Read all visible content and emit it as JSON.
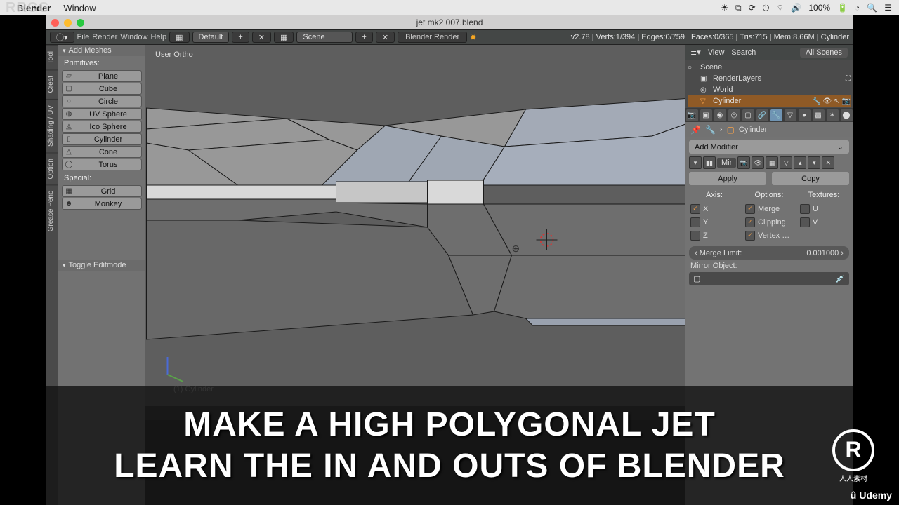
{
  "menubar": {
    "app": "Blender",
    "items": [
      "Window"
    ],
    "battery": "100%"
  },
  "window": {
    "title": "jet mk2 007.blend"
  },
  "top": {
    "file": "File",
    "render": "Render",
    "window": "Window",
    "help": "Help",
    "layout": "Default",
    "scene_label": "Scene",
    "engine": "Blender Render",
    "stats": "v2.78 | Verts:1/394 | Edges:0/759 | Faces:0/365 | Tris:715 | Mem:8.66M | Cylinder"
  },
  "left_tabs": [
    "Tool",
    "Creat",
    "Shading / UV",
    "Option",
    "Grease Penc"
  ],
  "toolshelf": {
    "panel": "Add Meshes",
    "primitives_label": "Primitives:",
    "primitives": [
      "Plane",
      "Cube",
      "Circle",
      "UV Sphere",
      "Ico Sphere",
      "Cylinder",
      "Cone",
      "Torus"
    ],
    "special_label": "Special:",
    "special": [
      "Grid",
      "Monkey"
    ],
    "op_panel": "Toggle Editmode"
  },
  "viewport": {
    "projection": "User Ortho",
    "obj": "(1) Cylinder"
  },
  "outliner": {
    "view": "View",
    "search": "Search",
    "filter": "All Scenes",
    "scene": "Scene",
    "renderlayers": "RenderLayers",
    "world": "World",
    "cylinder": "Cylinder"
  },
  "props": {
    "crumb_obj": "Cylinder",
    "add_modifier": "Add Modifier",
    "mod_name": "Mir",
    "apply": "Apply",
    "copy": "Copy",
    "axis": "Axis:",
    "options": "Options:",
    "textures": "Textures:",
    "x": "X",
    "y": "Y",
    "z": "Z",
    "merge": "Merge",
    "clipping": "Clipping",
    "vertex": "Vertex …",
    "u": "U",
    "v": "V",
    "merge_limit_label": "Merge Limit:",
    "merge_limit": "0.001000",
    "mirror_object": "Mirror Object:"
  },
  "caption": {
    "line1": "MAKE A HIGH POLYGONAL JET",
    "line2": "LEARN THE IN AND OUTS OF BLENDER"
  },
  "brand": {
    "wm": "RRCG",
    "udemy": "Udemy",
    "rrcg_big": "R",
    "rrcg_sub": "人人素材"
  }
}
